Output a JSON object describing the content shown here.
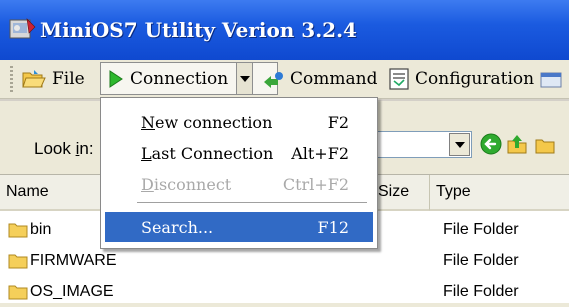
{
  "window": {
    "title": "MiniOS7 Utility Verion 3.2.4"
  },
  "toolbar": {
    "file_label": "File",
    "connection_label": "Connection",
    "command_label": "Command",
    "configuration_label": "Configuration"
  },
  "lookin": {
    "label_prefix": "Look ",
    "label_accel": "i",
    "label_suffix": "n:"
  },
  "list": {
    "columns": [
      "Name",
      "Size",
      "Type"
    ],
    "rows": [
      {
        "name": "bin",
        "type": "File Folder"
      },
      {
        "name": "FIRMWARE",
        "type": "File Folder"
      },
      {
        "name": "OS_IMAGE",
        "type": "File Folder"
      }
    ]
  },
  "menu": {
    "items": [
      {
        "accel": "N",
        "rest": "ew connection",
        "shortcut": "F2",
        "enabled": true
      },
      {
        "accel": "L",
        "rest": "ast Connection",
        "shortcut": "Alt+F2",
        "enabled": true
      },
      {
        "accel": "D",
        "rest": "isconnect",
        "shortcut": "Ctrl+F2",
        "enabled": false
      },
      {
        "accel": "",
        "rest": "Search...",
        "shortcut": "F12",
        "enabled": true,
        "highlighted": true
      }
    ]
  },
  "colors": {
    "titlebar": "#1b5be0",
    "menu_highlight": "#316ac5",
    "disabled_text": "#a9a9a9",
    "folder": "#f5cf5a"
  },
  "icons": {
    "app": "minios7-app-icon",
    "file": "folder-open-icon",
    "connection": "green-play-icon",
    "command": "command-arrow-icon",
    "configuration": "configuration-icon",
    "back": "back-arrow-icon",
    "up": "up-folder-icon"
  }
}
